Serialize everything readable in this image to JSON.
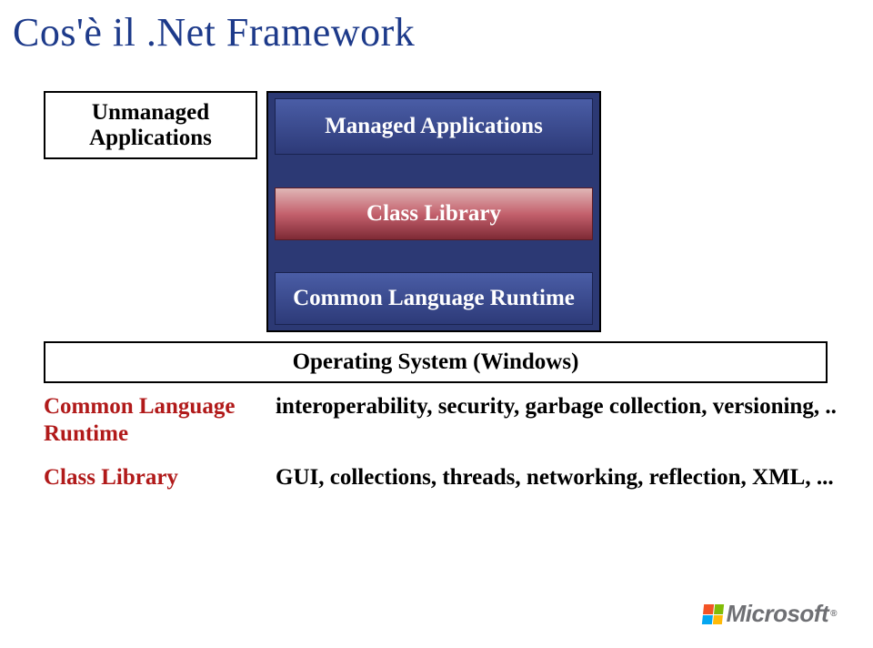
{
  "title": "Cos'è il .Net Framework",
  "diagram": {
    "unmanaged_line1": "Unmanaged",
    "unmanaged_line2": "Applications",
    "managed": "Managed Applications",
    "class_library": "Class Library",
    "clr": "Common Language Runtime",
    "os": "Operating System (Windows)"
  },
  "defs": {
    "clr_term_line1": "Common Language",
    "clr_term_line2": "Runtime",
    "clr_desc": "interoperability, security, garbage collection, versioning, ..",
    "cl_term": "Class Library",
    "cl_desc": "GUI, collections, threads, networking, reflection, XML, ..."
  },
  "logo": {
    "text": "Microsoft",
    "reg": "®"
  }
}
